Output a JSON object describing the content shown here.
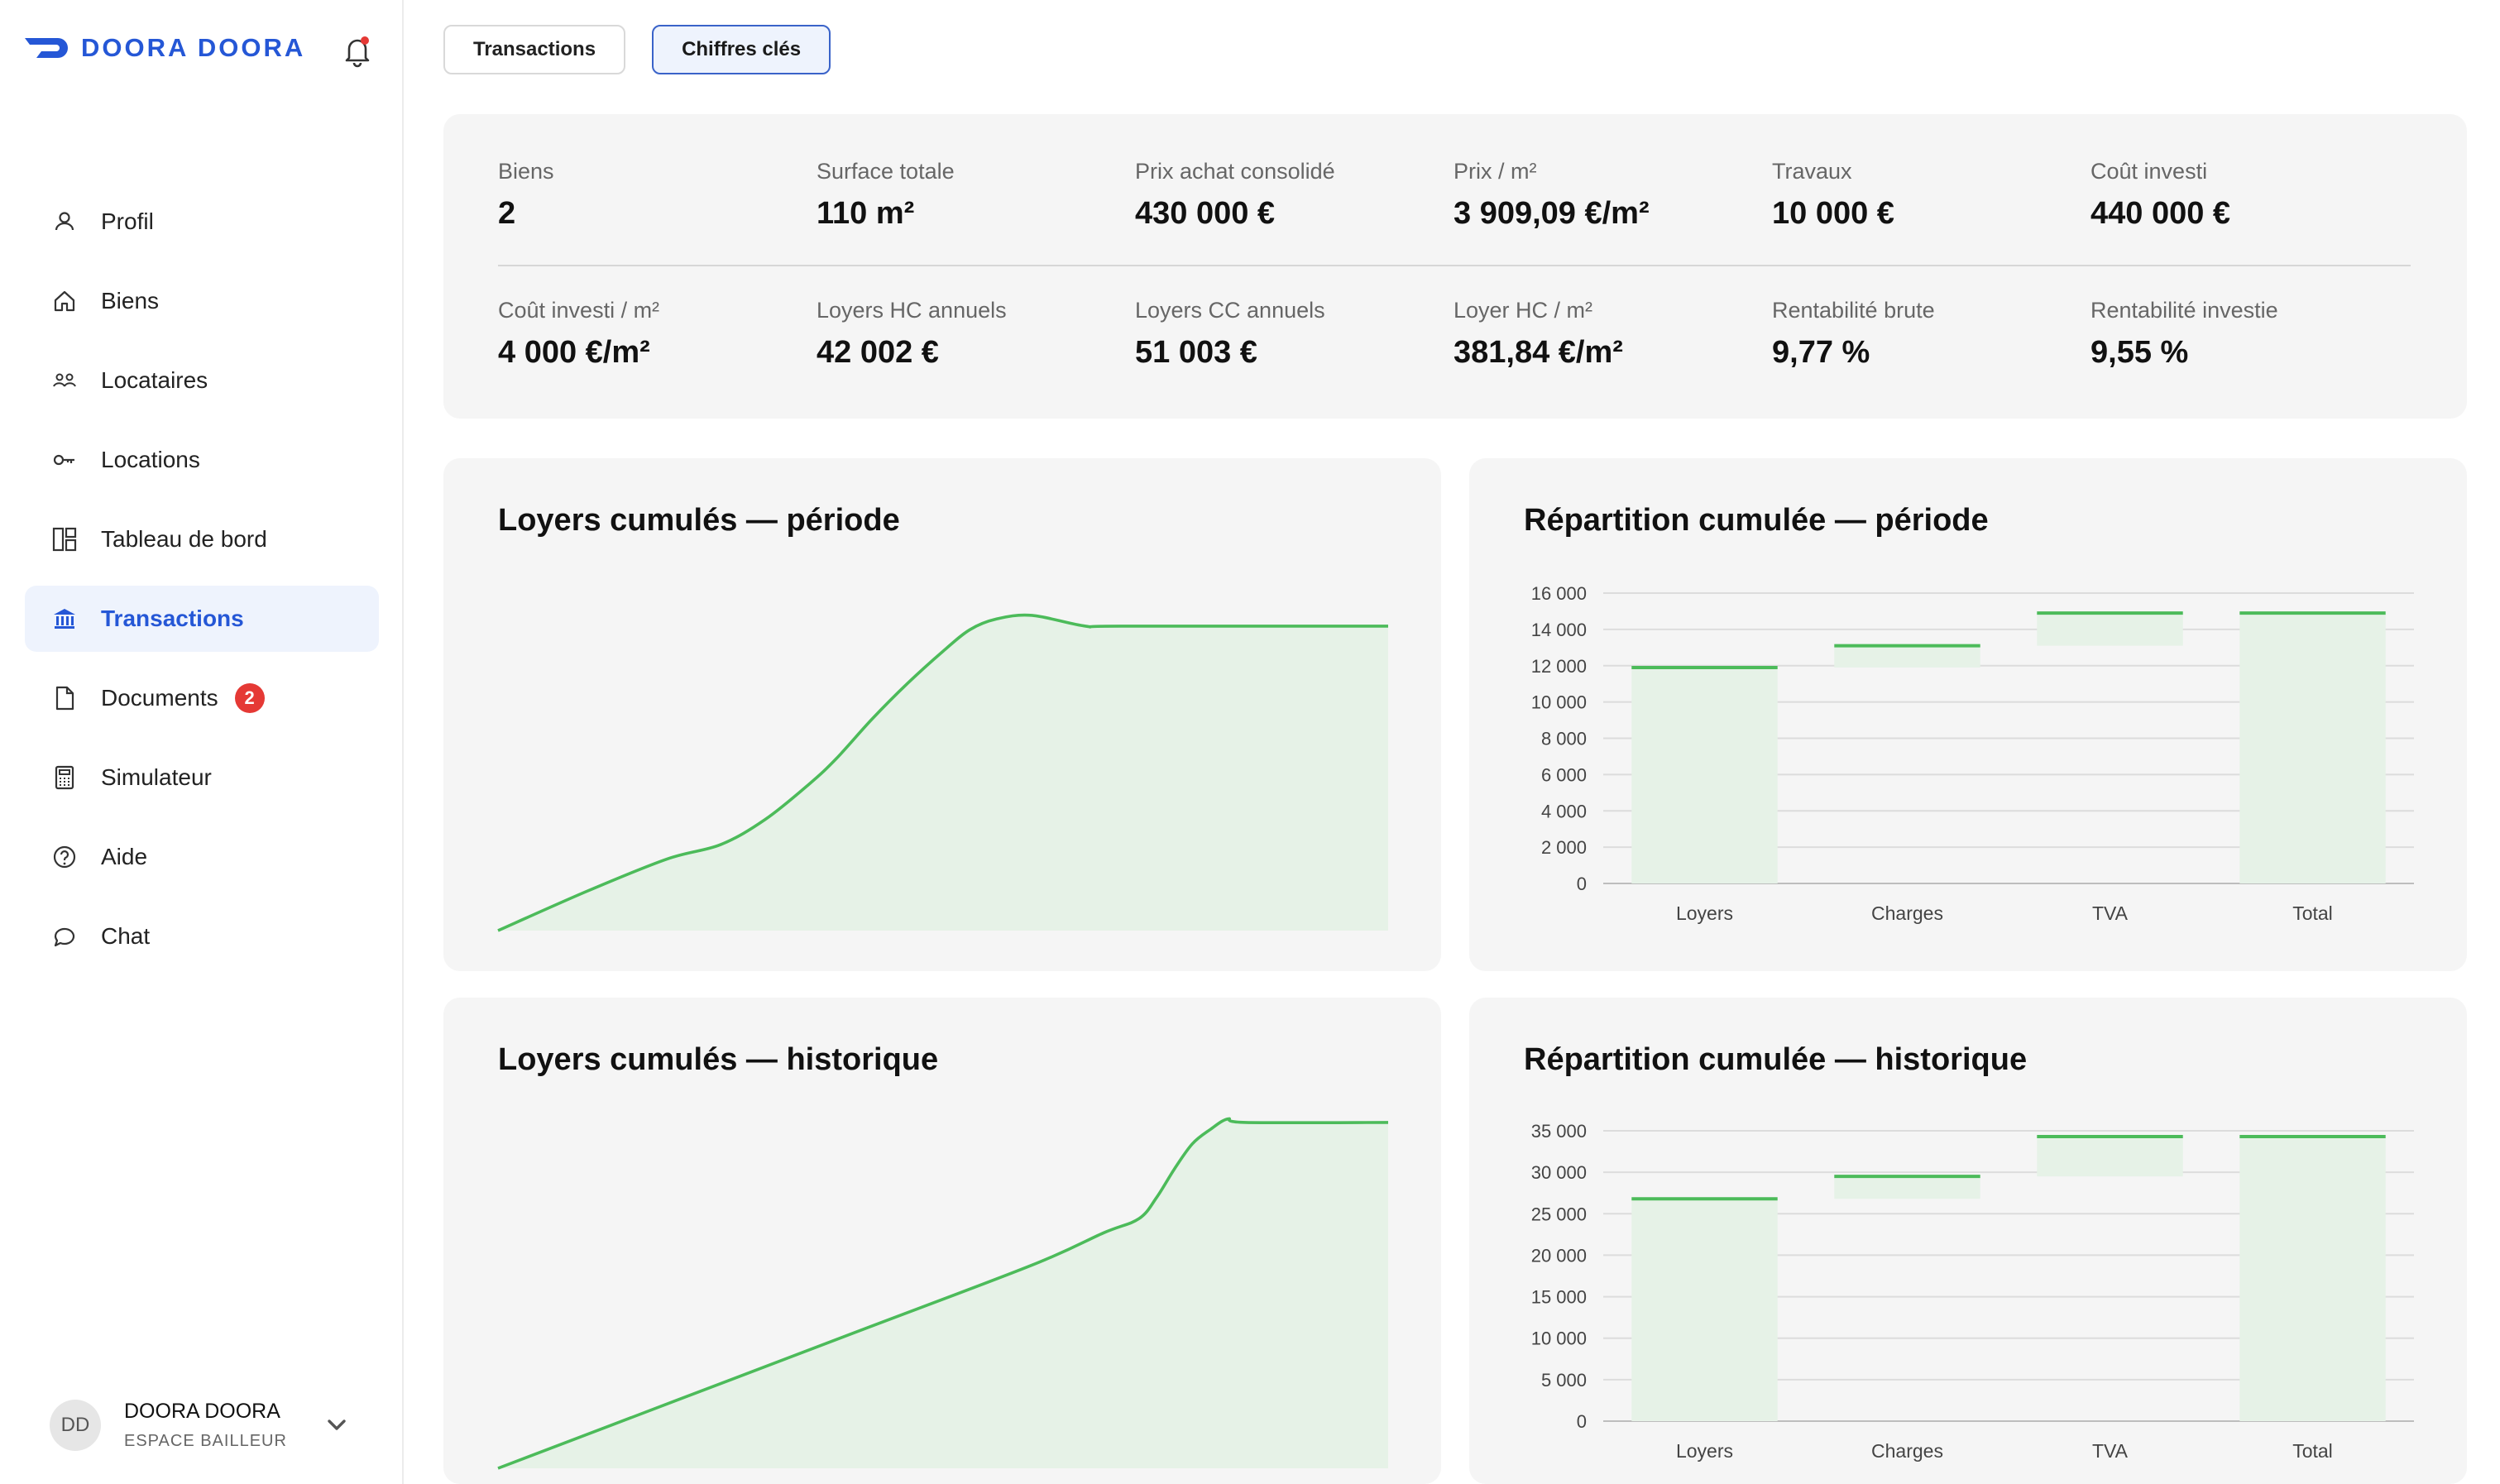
{
  "brand": {
    "name": "DOORA DOORA",
    "accent": "#2557d6"
  },
  "sidebar": {
    "items": [
      {
        "label": "Profil",
        "icon": "user-icon"
      },
      {
        "label": "Biens",
        "icon": "home-icon"
      },
      {
        "label": "Locataires",
        "icon": "users-icon"
      },
      {
        "label": "Locations",
        "icon": "key-icon"
      },
      {
        "label": "Tableau de bord",
        "icon": "dashboard-icon"
      },
      {
        "label": "Transactions",
        "icon": "bank-icon",
        "active": true
      },
      {
        "label": "Documents",
        "icon": "document-icon",
        "badge": "2"
      },
      {
        "label": "Simulateur",
        "icon": "calculator-icon"
      },
      {
        "label": "Aide",
        "icon": "help-icon"
      },
      {
        "label": "Chat",
        "icon": "chat-icon"
      }
    ]
  },
  "user": {
    "initials": "DD",
    "name": "DOORA DOORA",
    "role": "ESPACE BAILLEUR"
  },
  "tabs": [
    {
      "label": "Transactions",
      "active": false
    },
    {
      "label": "Chiffres clés",
      "active": true
    }
  ],
  "kpis": [
    {
      "label": "Biens",
      "value": "2"
    },
    {
      "label": "Surface totale",
      "value": "110 m²"
    },
    {
      "label": "Prix achat consolidé",
      "value": "430 000 €"
    },
    {
      "label": "Prix / m²",
      "value": "3 909,09 €/m²"
    },
    {
      "label": "Travaux",
      "value": "10 000 €"
    },
    {
      "label": "Coût investi",
      "value": "440 000 €"
    },
    {
      "label": "Coût investi / m²",
      "value": "4 000 €/m²"
    },
    {
      "label": "Loyers HC annuels",
      "value": "42 002 €"
    },
    {
      "label": "Loyers CC annuels",
      "value": "51 003 €"
    },
    {
      "label": "Loyer HC / m²",
      "value": "381,84 €/m²"
    },
    {
      "label": "Rentabilité brute",
      "value": "9,77 %"
    },
    {
      "label": "Rentabilité investie",
      "value": "9,55 %"
    }
  ],
  "chart_data": [
    {
      "type": "area",
      "title": "Loyers cumulés — période",
      "x": [
        0,
        0.1,
        0.19,
        0.25,
        0.3,
        0.35,
        0.38,
        0.42,
        0.46,
        0.5,
        0.53,
        0.56,
        0.6,
        0.66,
        0.7,
        1.0
      ],
      "values": [
        0.0,
        0.11,
        0.2,
        0.24,
        0.31,
        0.41,
        0.48,
        0.59,
        0.69,
        0.78,
        0.84,
        0.87,
        0.88,
        0.85,
        0.85,
        0.85
      ],
      "color": "#4cbb5a"
    },
    {
      "type": "bar",
      "title": "Répartition cumulée — période",
      "categories": [
        "Loyers",
        "Charges",
        "TVA",
        "Total"
      ],
      "ylim": [
        0,
        16000
      ],
      "yticks": [
        "0",
        "2 000",
        "4 000",
        "6 000",
        "8 000",
        "10 000",
        "12 000",
        "14 000",
        "16 000"
      ],
      "bars": [
        {
          "start": 0,
          "end": 11900
        },
        {
          "start": 11900,
          "end": 13100
        },
        {
          "start": 13100,
          "end": 14900
        },
        {
          "start": 0,
          "end": 14900
        }
      ],
      "grid": true,
      "color": "#4cbb5a"
    },
    {
      "type": "area",
      "title": "Loyers cumulés — historique",
      "x": [
        0,
        0.2,
        0.4,
        0.6,
        0.68,
        0.72,
        0.74,
        0.76,
        0.78,
        0.8,
        0.82,
        0.84,
        1.0
      ],
      "values": [
        0.0,
        0.19,
        0.38,
        0.57,
        0.66,
        0.7,
        0.76,
        0.84,
        0.91,
        0.95,
        0.98,
        0.97,
        0.97
      ],
      "color": "#4cbb5a"
    },
    {
      "type": "bar",
      "title": "Répartition cumulée — historique",
      "categories": [
        "Loyers",
        "Charges",
        "TVA",
        "Total"
      ],
      "ylim": [
        0,
        35000
      ],
      "yticks": [
        "0",
        "5 000",
        "10 000",
        "15 000",
        "20 000",
        "25 000",
        "30 000",
        "35 000"
      ],
      "bars": [
        {
          "start": 0,
          "end": 26800
        },
        {
          "start": 26800,
          "end": 29500
        },
        {
          "start": 29500,
          "end": 34300
        },
        {
          "start": 0,
          "end": 34300
        }
      ],
      "grid": true,
      "color": "#4cbb5a"
    }
  ]
}
